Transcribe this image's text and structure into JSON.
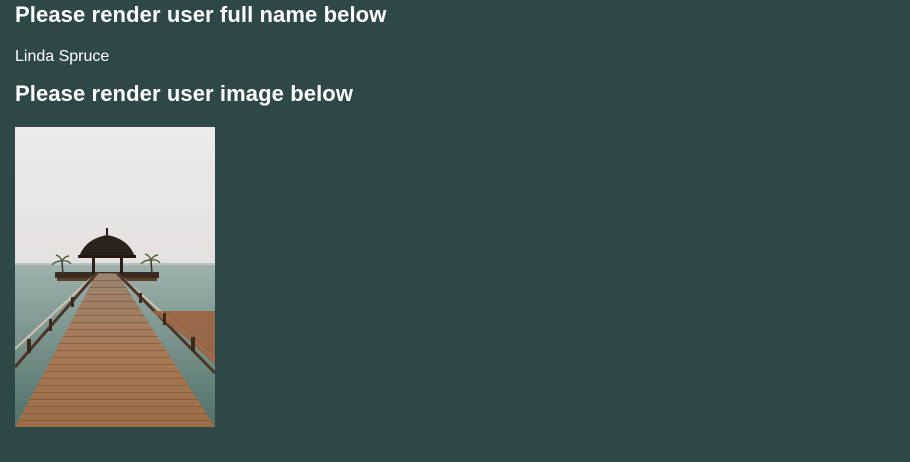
{
  "page": {
    "name_heading": "Please render user full name below",
    "full_name": "Linda Spruce",
    "image_heading": "Please render user image below"
  },
  "colors": {
    "background": "#2e4847",
    "text": "#ffffff"
  }
}
